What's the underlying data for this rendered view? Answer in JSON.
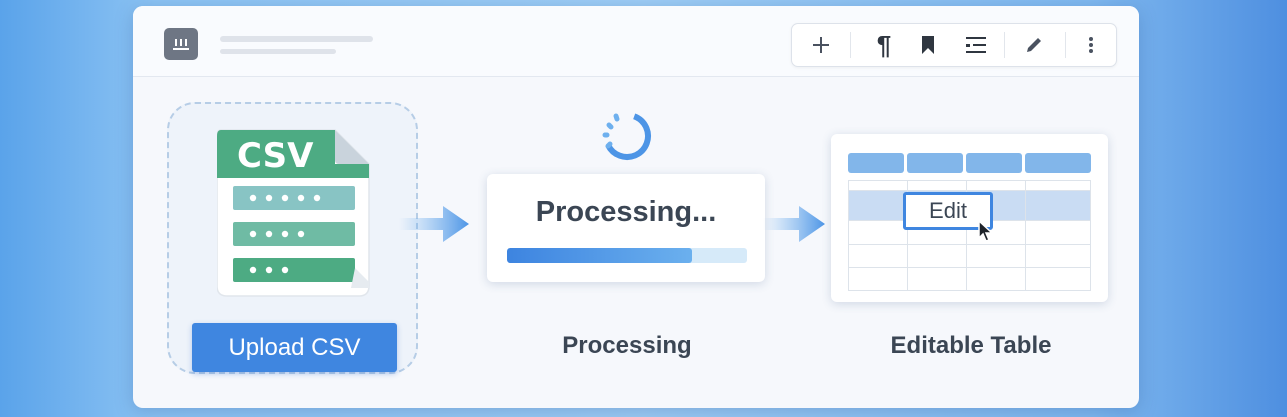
{
  "toolbar": {
    "buttons": [
      {
        "icon": "plus-icon"
      },
      {
        "icon": "pilcrow-icon",
        "glyph": "¶"
      },
      {
        "icon": "bookmark-icon"
      },
      {
        "icon": "indent-list-icon"
      },
      {
        "icon": "pencil-icon"
      },
      {
        "icon": "more-vertical-icon"
      }
    ]
  },
  "upload": {
    "file_badge": "CSV",
    "button_label": "Upload CSV"
  },
  "processing": {
    "card_title": "Processing...",
    "progress_fraction": 0.77,
    "caption": "Processing"
  },
  "table": {
    "cell_editor_text": "Edit",
    "caption": "Editable Table"
  },
  "colors": {
    "accent": "#3f86e0",
    "csv_green": "#4dab83",
    "csv_teal": "#88c4c4",
    "header_blue": "#82b6ea",
    "text_dark": "#3b4654"
  }
}
